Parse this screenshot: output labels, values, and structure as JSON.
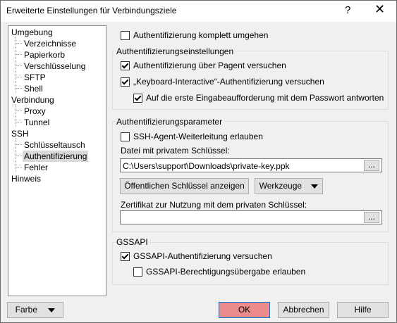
{
  "window": {
    "title": "Erweiterte Einstellungen für Verbindungsziele",
    "help": "?",
    "close": "✕"
  },
  "tree": {
    "umgebung": "Umgebung",
    "verzeichnisse": "Verzeichnisse",
    "papierkorb": "Papierkorb",
    "verschluesselung": "Verschlüsselung",
    "sftp": "SFTP",
    "shell": "Shell",
    "verbindung": "Verbindung",
    "proxy": "Proxy",
    "tunnel": "Tunnel",
    "ssh": "SSH",
    "schluesselaustausch": "Schlüsseltausch",
    "authentifizierung": "Authentifizierung",
    "fehler": "Fehler",
    "hinweis": "Hinweis"
  },
  "auth": {
    "bypass": {
      "label": "Authentifizierung komplett umgehen",
      "checked": false
    },
    "group_title": "Authentifizierungseinstellungen",
    "pagent": {
      "label": "Authentifizierung über Pagent versuchen",
      "checked": true
    },
    "keyboard": {
      "label": "„Keyboard-Interactive“-Authentifizierung versuchen",
      "checked": true
    },
    "password_first": {
      "label": "Auf die erste Eingabeaufforderung mit dem Passwort antworten",
      "checked": true
    }
  },
  "params": {
    "group_title": "Authentifizierungsparameter",
    "agent_forward": {
      "label": "SSH-Agent-Weiterleitung erlauben",
      "checked": false
    },
    "key_label": "Datei mit privatem Schlüssel:",
    "key_value": "C:\\Users\\support\\Downloads\\private-key.ppk",
    "browse": "...",
    "show_public": "Öffentlichen Schlüssel anzeigen ...",
    "tools": "Werkzeuge",
    "cert_label": "Zertifikat zur Nutzung mit dem privaten Schlüssel:",
    "cert_value": "",
    "cert_browse": "..."
  },
  "gssapi": {
    "group_title": "GSSAPI",
    "try": {
      "label": "GSSAPI-Authentifizierung versuchen",
      "checked": true
    },
    "delegate": {
      "label": "GSSAPI-Berechtigungsübergabe erlauben",
      "checked": false
    }
  },
  "footer": {
    "color": "Farbe",
    "ok": "OK",
    "cancel": "Abbrechen",
    "help": "Hilfe"
  },
  "colors": {
    "ok_bg": "#eb8b8b",
    "selection": "#d9d9d9"
  }
}
